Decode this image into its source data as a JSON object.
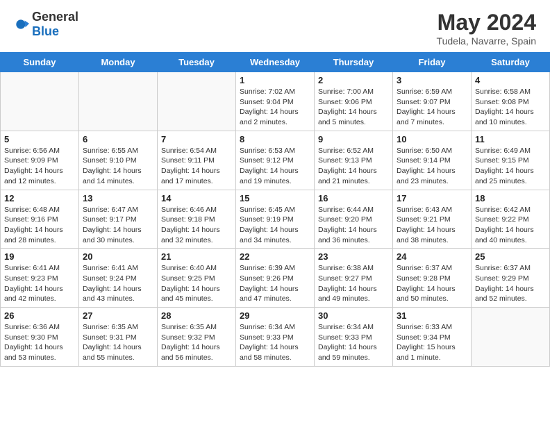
{
  "header": {
    "logo_general": "General",
    "logo_blue": "Blue",
    "month": "May 2024",
    "location": "Tudela, Navarre, Spain"
  },
  "days_of_week": [
    "Sunday",
    "Monday",
    "Tuesday",
    "Wednesday",
    "Thursday",
    "Friday",
    "Saturday"
  ],
  "weeks": [
    [
      {
        "num": "",
        "info": ""
      },
      {
        "num": "",
        "info": ""
      },
      {
        "num": "",
        "info": ""
      },
      {
        "num": "1",
        "info": "Sunrise: 7:02 AM\nSunset: 9:04 PM\nDaylight: 14 hours and 2 minutes."
      },
      {
        "num": "2",
        "info": "Sunrise: 7:00 AM\nSunset: 9:06 PM\nDaylight: 14 hours and 5 minutes."
      },
      {
        "num": "3",
        "info": "Sunrise: 6:59 AM\nSunset: 9:07 PM\nDaylight: 14 hours and 7 minutes."
      },
      {
        "num": "4",
        "info": "Sunrise: 6:58 AM\nSunset: 9:08 PM\nDaylight: 14 hours and 10 minutes."
      }
    ],
    [
      {
        "num": "5",
        "info": "Sunrise: 6:56 AM\nSunset: 9:09 PM\nDaylight: 14 hours and 12 minutes."
      },
      {
        "num": "6",
        "info": "Sunrise: 6:55 AM\nSunset: 9:10 PM\nDaylight: 14 hours and 14 minutes."
      },
      {
        "num": "7",
        "info": "Sunrise: 6:54 AM\nSunset: 9:11 PM\nDaylight: 14 hours and 17 minutes."
      },
      {
        "num": "8",
        "info": "Sunrise: 6:53 AM\nSunset: 9:12 PM\nDaylight: 14 hours and 19 minutes."
      },
      {
        "num": "9",
        "info": "Sunrise: 6:52 AM\nSunset: 9:13 PM\nDaylight: 14 hours and 21 minutes."
      },
      {
        "num": "10",
        "info": "Sunrise: 6:50 AM\nSunset: 9:14 PM\nDaylight: 14 hours and 23 minutes."
      },
      {
        "num": "11",
        "info": "Sunrise: 6:49 AM\nSunset: 9:15 PM\nDaylight: 14 hours and 25 minutes."
      }
    ],
    [
      {
        "num": "12",
        "info": "Sunrise: 6:48 AM\nSunset: 9:16 PM\nDaylight: 14 hours and 28 minutes."
      },
      {
        "num": "13",
        "info": "Sunrise: 6:47 AM\nSunset: 9:17 PM\nDaylight: 14 hours and 30 minutes."
      },
      {
        "num": "14",
        "info": "Sunrise: 6:46 AM\nSunset: 9:18 PM\nDaylight: 14 hours and 32 minutes."
      },
      {
        "num": "15",
        "info": "Sunrise: 6:45 AM\nSunset: 9:19 PM\nDaylight: 14 hours and 34 minutes."
      },
      {
        "num": "16",
        "info": "Sunrise: 6:44 AM\nSunset: 9:20 PM\nDaylight: 14 hours and 36 minutes."
      },
      {
        "num": "17",
        "info": "Sunrise: 6:43 AM\nSunset: 9:21 PM\nDaylight: 14 hours and 38 minutes."
      },
      {
        "num": "18",
        "info": "Sunrise: 6:42 AM\nSunset: 9:22 PM\nDaylight: 14 hours and 40 minutes."
      }
    ],
    [
      {
        "num": "19",
        "info": "Sunrise: 6:41 AM\nSunset: 9:23 PM\nDaylight: 14 hours and 42 minutes."
      },
      {
        "num": "20",
        "info": "Sunrise: 6:41 AM\nSunset: 9:24 PM\nDaylight: 14 hours and 43 minutes."
      },
      {
        "num": "21",
        "info": "Sunrise: 6:40 AM\nSunset: 9:25 PM\nDaylight: 14 hours and 45 minutes."
      },
      {
        "num": "22",
        "info": "Sunrise: 6:39 AM\nSunset: 9:26 PM\nDaylight: 14 hours and 47 minutes."
      },
      {
        "num": "23",
        "info": "Sunrise: 6:38 AM\nSunset: 9:27 PM\nDaylight: 14 hours and 49 minutes."
      },
      {
        "num": "24",
        "info": "Sunrise: 6:37 AM\nSunset: 9:28 PM\nDaylight: 14 hours and 50 minutes."
      },
      {
        "num": "25",
        "info": "Sunrise: 6:37 AM\nSunset: 9:29 PM\nDaylight: 14 hours and 52 minutes."
      }
    ],
    [
      {
        "num": "26",
        "info": "Sunrise: 6:36 AM\nSunset: 9:30 PM\nDaylight: 14 hours and 53 minutes."
      },
      {
        "num": "27",
        "info": "Sunrise: 6:35 AM\nSunset: 9:31 PM\nDaylight: 14 hours and 55 minutes."
      },
      {
        "num": "28",
        "info": "Sunrise: 6:35 AM\nSunset: 9:32 PM\nDaylight: 14 hours and 56 minutes."
      },
      {
        "num": "29",
        "info": "Sunrise: 6:34 AM\nSunset: 9:33 PM\nDaylight: 14 hours and 58 minutes."
      },
      {
        "num": "30",
        "info": "Sunrise: 6:34 AM\nSunset: 9:33 PM\nDaylight: 14 hours and 59 minutes."
      },
      {
        "num": "31",
        "info": "Sunrise: 6:33 AM\nSunset: 9:34 PM\nDaylight: 15 hours and 1 minute."
      },
      {
        "num": "",
        "info": ""
      }
    ]
  ]
}
